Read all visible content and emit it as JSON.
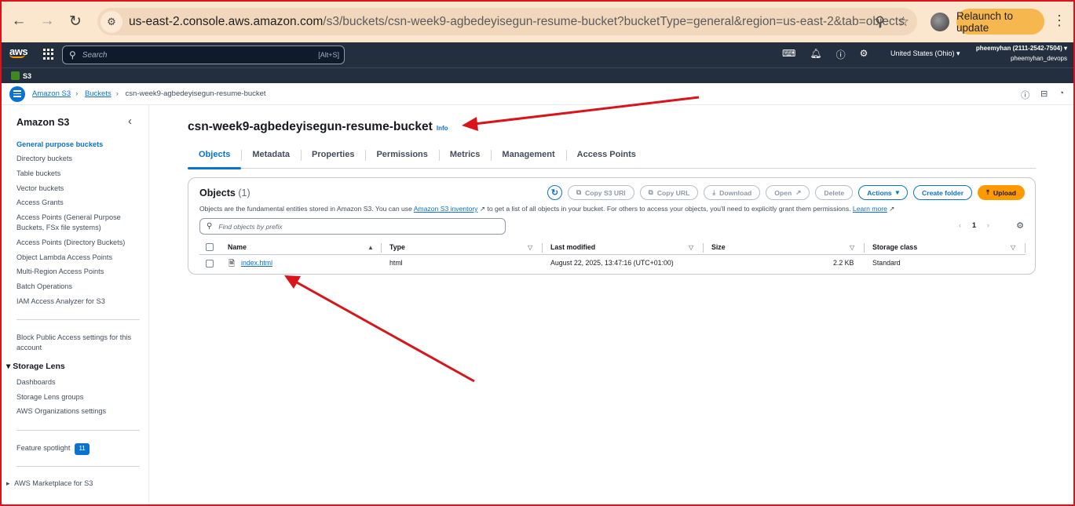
{
  "browser": {
    "url_host": "us-east-2.console.aws.amazon.com",
    "url_path": "/s3/buckets/csn-week9-agbedeyisegun-resume-bucket?bucketType=general&region=us-east-2&tab=objects",
    "relaunch_label": "Relaunch to update",
    "back_glyph": "←",
    "forward_glyph": "→",
    "reload_glyph": "↻",
    "site_glyph": "⚙",
    "zoom_glyph": "⚲",
    "star_glyph": "☆",
    "menu_glyph": "⋮"
  },
  "aws_nav": {
    "logo": "aws",
    "search_placeholder": "Search",
    "search_shortcut": "[Alt+S]",
    "region": "United States (Ohio) ▾",
    "account": "pheemyhan (2111-2542-7504) ▾",
    "user": "pheemyhan_devops",
    "icons": [
      "cloudshell-icon",
      "bell-icon",
      "help-icon",
      "settings-icon"
    ]
  },
  "service_bar": {
    "name": "S3"
  },
  "breadcrumb": {
    "items": [
      "Amazon S3",
      "Buckets"
    ],
    "current": "csn-week9-agbedeyisegun-resume-bucket"
  },
  "sidebar": {
    "title": "Amazon S3",
    "items": [
      "General purpose buckets",
      "Directory buckets",
      "Table buckets",
      "Vector buckets",
      "Access Grants",
      "Access Points (General Purpose Buckets, FSx file systems)",
      "Access Points (Directory Buckets)",
      "Object Lambda Access Points",
      "Multi-Region Access Points",
      "Batch Operations",
      "IAM Access Analyzer for S3"
    ],
    "block_public": "Block Public Access settings for this account",
    "storage_lens": {
      "title": "Storage Lens",
      "items": [
        "Dashboards",
        "Storage Lens groups",
        "AWS Organizations settings"
      ]
    },
    "feature_spotlight": "Feature spotlight",
    "feature_count": "11",
    "marketplace": "AWS Marketplace for S3"
  },
  "main": {
    "bucket_name": "csn-week9-agbedeyisegun-resume-bucket",
    "info": "Info",
    "tabs": [
      "Objects",
      "Metadata",
      "Properties",
      "Permissions",
      "Metrics",
      "Management",
      "Access Points"
    ],
    "objects_panel": {
      "title": "Objects",
      "count": "(1)",
      "desc_1": "Objects are the fundamental entities stored in Amazon S3. You can use ",
      "desc_link": "Amazon S3 inventory",
      "desc_2": " to get a list of all objects in your bucket. For others to access your objects, you'll need to explicitly grant them permissions. ",
      "learn_more": "Learn more",
      "buttons": {
        "copy_uri": "Copy S3 URI",
        "copy_url": "Copy URL",
        "download": "Download",
        "open": "Open",
        "delete": "Delete",
        "actions": "Actions",
        "create_folder": "Create folder",
        "upload": "Upload"
      },
      "search_placeholder": "Find objects by prefix",
      "page": "1",
      "columns": [
        "Name",
        "Type",
        "Last modified",
        "Size",
        "Storage class"
      ],
      "rows": [
        {
          "name": "index.html",
          "type": "html",
          "modified": "August 22, 2025, 13:47:16 (UTC+01:00)",
          "size": "2.2 KB",
          "class": "Standard"
        }
      ]
    }
  },
  "colors": {
    "accent": "#0972d3",
    "primary": "#ff9900",
    "nav_bg": "#232f3e",
    "annotation": "#d9141b"
  }
}
